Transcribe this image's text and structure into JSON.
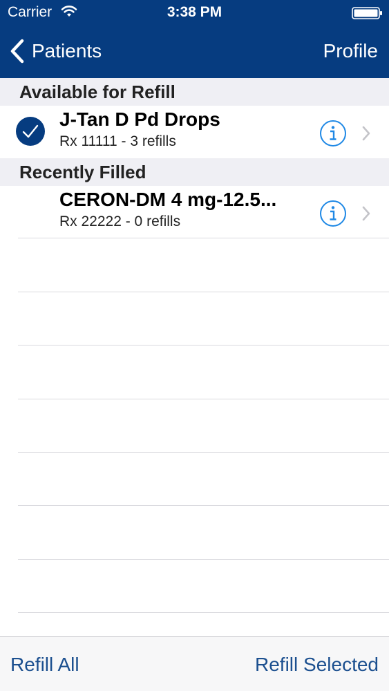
{
  "status_bar": {
    "carrier": "Carrier",
    "time": "3:38 PM",
    "icons": [
      "wifi-icon",
      "battery-icon"
    ]
  },
  "nav": {
    "back_label": "Patients",
    "right_label": "Profile",
    "background": "#063C80"
  },
  "sections": [
    {
      "title": "Available for Refill",
      "items": [
        {
          "name": "J-Tan D Pd Drops",
          "detail": "Rx 11111 - 3 refills",
          "selected": true
        }
      ]
    },
    {
      "title": "Recently Filled",
      "items": [
        {
          "name": "CERON-DM 4 mg-12.5...",
          "detail": "Rx 22222 - 0 refills",
          "selected": false
        }
      ]
    }
  ],
  "toolbar": {
    "left_label": "Refill All",
    "right_label": "Refill Selected"
  },
  "colors": {
    "accent": "#063C80",
    "info_blue": "#1E88E5",
    "toolbar_text": "#1B4F8F"
  }
}
